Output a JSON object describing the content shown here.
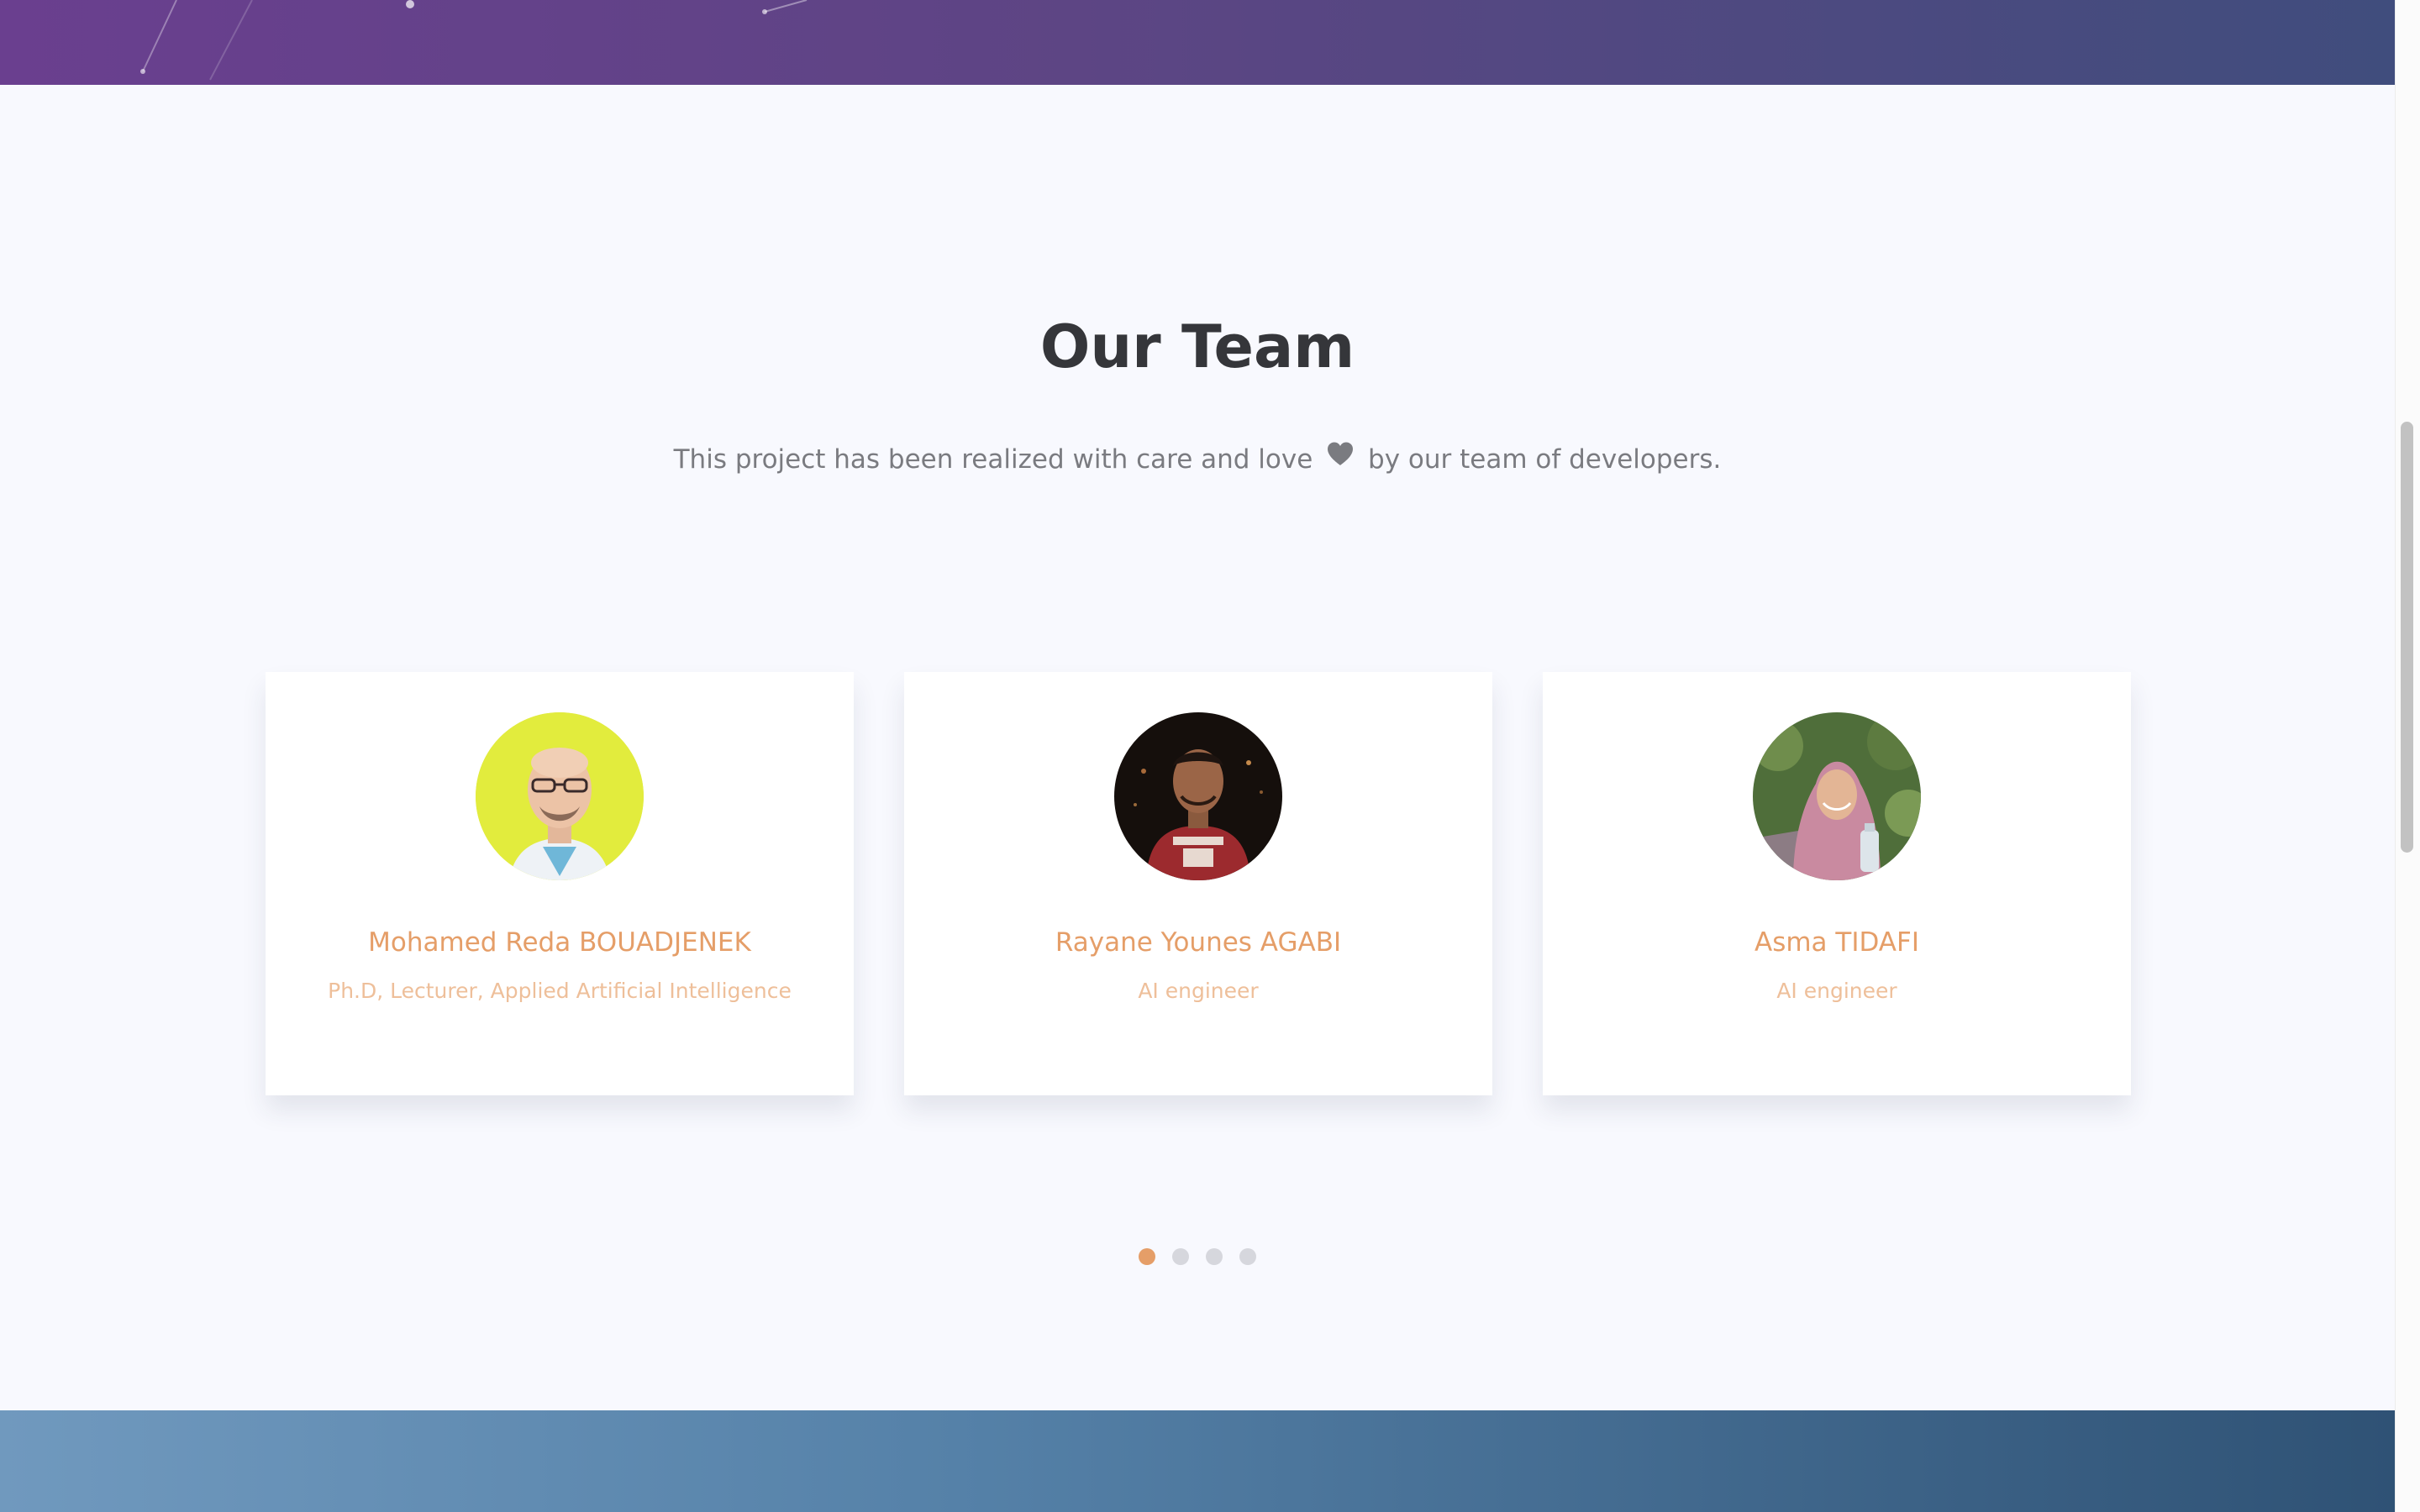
{
  "team": {
    "title": "Our Team",
    "subtitle_before": "This project has been realized with care and love",
    "subtitle_after": "by our team of developers.",
    "heart_icon": "heart-icon",
    "members": [
      {
        "name": "Mohamed Reda BOUADJENEK",
        "role": "Ph.D, Lecturer, Applied Artificial Intelligence",
        "avatar": "profile-photo"
      },
      {
        "name": "Rayane Younes AGABI",
        "role": "AI engineer",
        "avatar": "profile-photo"
      },
      {
        "name": "Asma TIDAFI",
        "role": "AI engineer",
        "avatar": "profile-photo"
      }
    ],
    "carousel": {
      "page_count": 4,
      "active_page": 1
    }
  },
  "colors": {
    "accent": "#e59e68",
    "title": "#35363a",
    "background": "#f8f9fe",
    "top_band_start": "#6a3f8f",
    "top_band_end": "#404d7d",
    "bottom_band_start": "#7099be",
    "bottom_band_end": "#2f5275"
  }
}
